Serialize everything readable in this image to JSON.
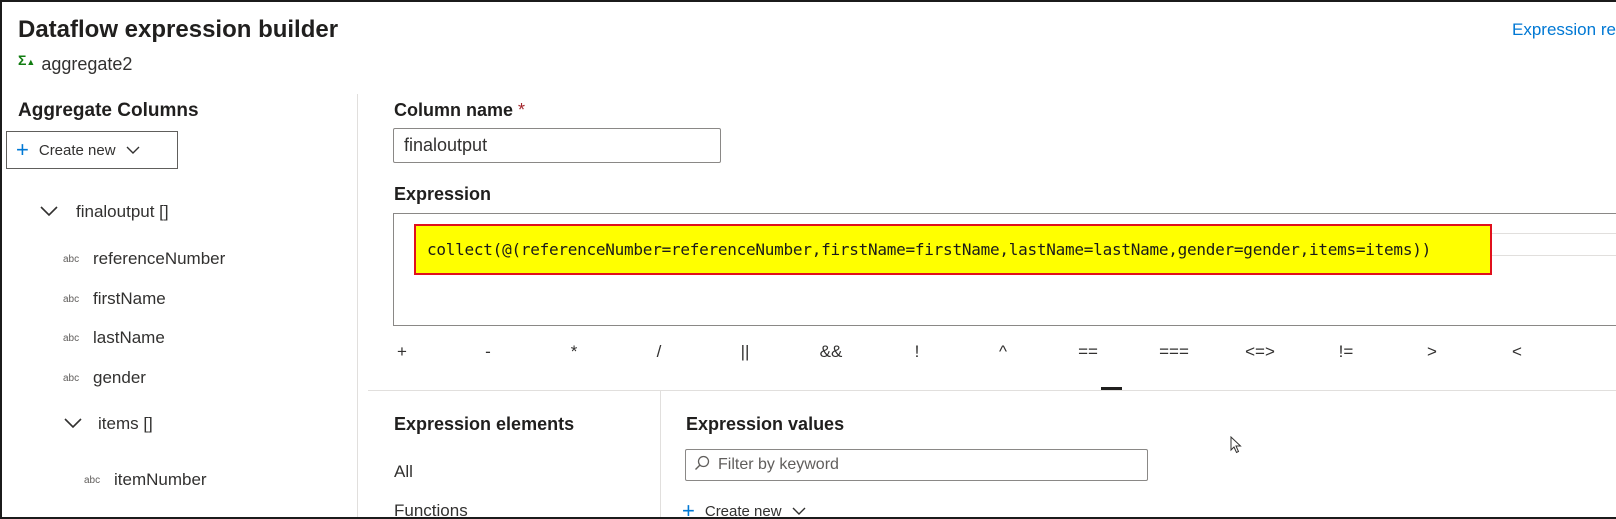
{
  "header": {
    "title": "Dataflow expression builder",
    "expression_reference_link": "Expression ref",
    "transform_icon": "sigma-aggregate-icon",
    "transform_name": "aggregate2"
  },
  "left_panel": {
    "title": "Aggregate Columns",
    "create_new_label": "Create new",
    "tree": {
      "root": {
        "label": "finaloutput []",
        "expanded": true
      },
      "children": [
        {
          "type_badge": "abc",
          "label": "referenceNumber"
        },
        {
          "type_badge": "abc",
          "label": "firstName"
        },
        {
          "type_badge": "abc",
          "label": "lastName"
        },
        {
          "type_badge": "abc",
          "label": "gender"
        }
      ],
      "nested": {
        "label": "items []",
        "expanded": true
      },
      "nested_children": [
        {
          "type_badge": "abc",
          "label": "itemNumber"
        }
      ]
    }
  },
  "editor": {
    "column_name_label": "Column name",
    "required_marker": "*",
    "column_name_value": "finaloutput",
    "expression_label": "Expression",
    "expression_text": "collect(@(referenceNumber=referenceNumber,firstName=firstName,lastName=lastName,gender=gender,items=items))",
    "highlight_color": "#ffff00",
    "highlight_border_color": "#e0101c",
    "operators": [
      "+",
      "-",
      "*",
      "/",
      "||",
      "&&",
      "!",
      "^",
      "==",
      "===",
      "<=>",
      "!=",
      ">",
      "<"
    ],
    "selected_operator": "=="
  },
  "bottom": {
    "elements_title": "Expression elements",
    "elements": [
      "All",
      "Functions"
    ],
    "values_title": "Expression values",
    "filter_placeholder": "Filter by keyword",
    "create_new_label": "Create new"
  },
  "colors": {
    "accent": "#0078d4",
    "sigma_icon": "#107c10"
  }
}
